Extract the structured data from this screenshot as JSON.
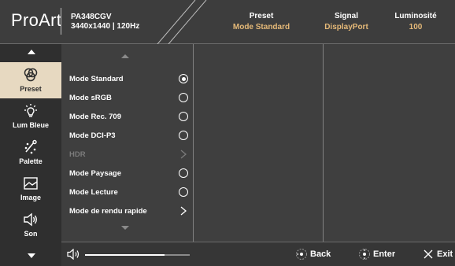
{
  "header": {
    "brand": "ProArt",
    "model": "PA348CGV",
    "resolution": "3440x1440 | 120Hz",
    "stats": [
      {
        "label": "Preset",
        "value": "Mode Standard"
      },
      {
        "label": "Signal",
        "value": "DisplayPort"
      },
      {
        "label": "Luminosité",
        "value": "100"
      }
    ]
  },
  "sidebar": {
    "items": [
      {
        "label": "Preset",
        "icon": "preset-icon",
        "active": true
      },
      {
        "label": "Lum Bleue",
        "icon": "blue-light-icon",
        "active": false
      },
      {
        "label": "Palette",
        "icon": "palette-icon",
        "active": false
      },
      {
        "label": "Image",
        "icon": "image-icon",
        "active": false
      },
      {
        "label": "Son",
        "icon": "sound-icon",
        "active": false
      }
    ]
  },
  "menu": {
    "options": [
      {
        "label": "Mode Standard",
        "control": "radio",
        "selected": true,
        "enabled": true
      },
      {
        "label": "Mode sRGB",
        "control": "radio",
        "selected": false,
        "enabled": true
      },
      {
        "label": "Mode Rec. 709",
        "control": "radio",
        "selected": false,
        "enabled": true
      },
      {
        "label": "Mode DCI-P3",
        "control": "radio",
        "selected": false,
        "enabled": true
      },
      {
        "label": "HDR",
        "control": "submenu",
        "selected": false,
        "enabled": false
      },
      {
        "label": "Mode Paysage",
        "control": "radio",
        "selected": false,
        "enabled": true
      },
      {
        "label": "Mode Lecture",
        "control": "radio",
        "selected": false,
        "enabled": true
      },
      {
        "label": "Mode de rendu rapide",
        "control": "submenu",
        "selected": false,
        "enabled": true
      }
    ]
  },
  "footer": {
    "volume_level": 0.76,
    "back_label": "Back",
    "enter_label": "Enter",
    "exit_label": "Exit"
  },
  "colors": {
    "accent": "#e5b978",
    "active_tab_bg": "#e7d9c1"
  }
}
